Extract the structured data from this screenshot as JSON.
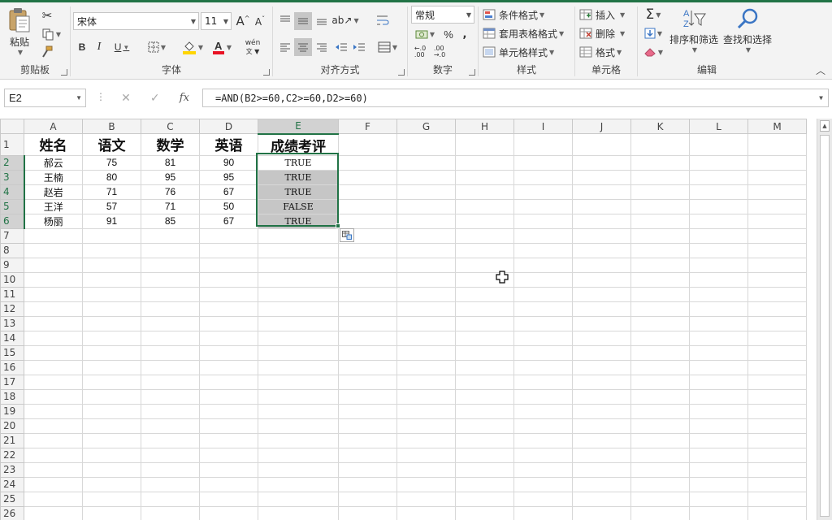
{
  "ribbon": {
    "clipboard": {
      "label": "剪贴板",
      "paste_label": "粘贴"
    },
    "font": {
      "label": "字体",
      "font_name": "宋体",
      "font_size": "11",
      "bold": "B",
      "italic": "I",
      "underline": "U",
      "phonetic": "wén"
    },
    "alignment": {
      "label": "对齐方式"
    },
    "number": {
      "label": "数字",
      "format": "常规",
      "percent": "%",
      "comma": ","
    },
    "styles": {
      "label": "样式",
      "conditional": "条件格式",
      "table_format": "套用表格格式",
      "cell_styles": "单元格样式"
    },
    "cells": {
      "label": "单元格",
      "insert": "插入",
      "delete": "删除",
      "format": "格式"
    },
    "editing": {
      "label": "编辑",
      "sort_filter": "排序和筛选",
      "find_select": "查找和选择"
    }
  },
  "formula_bar": {
    "name_box": "E2",
    "formula": "=AND(B2>=60,C2>=60,D2>=60)"
  },
  "sheet": {
    "columns": [
      "A",
      "B",
      "C",
      "D",
      "E",
      "F",
      "G",
      "H",
      "I",
      "J",
      "K",
      "L",
      "M"
    ],
    "selected_column": "E",
    "header_row": [
      "姓名",
      "语文",
      "数学",
      "英语",
      "成绩考评"
    ],
    "rows": [
      [
        "郝云",
        "75",
        "81",
        "90",
        "TRUE"
      ],
      [
        "王楠",
        "80",
        "95",
        "95",
        "TRUE"
      ],
      [
        "赵岩",
        "71",
        "76",
        "67",
        "TRUE"
      ],
      [
        "王洋",
        "57",
        "71",
        "50",
        "FALSE"
      ],
      [
        "杨丽",
        "91",
        "85",
        "67",
        "TRUE"
      ]
    ],
    "row_numbers": [
      "1",
      "2",
      "3",
      "4",
      "5",
      "6",
      "7",
      "8",
      "9",
      "10",
      "11",
      "12",
      "13",
      "14",
      "15",
      "16",
      "17",
      "18",
      "19",
      "20",
      "21",
      "22",
      "23",
      "24",
      "25",
      "26"
    ],
    "selected_rows": [
      "2",
      "3",
      "4",
      "5",
      "6"
    ]
  },
  "colors": {
    "accent": "#217346",
    "selection_fill": "#c6c6c6",
    "font_color": "#e81123",
    "highlight": "#ffd500"
  }
}
